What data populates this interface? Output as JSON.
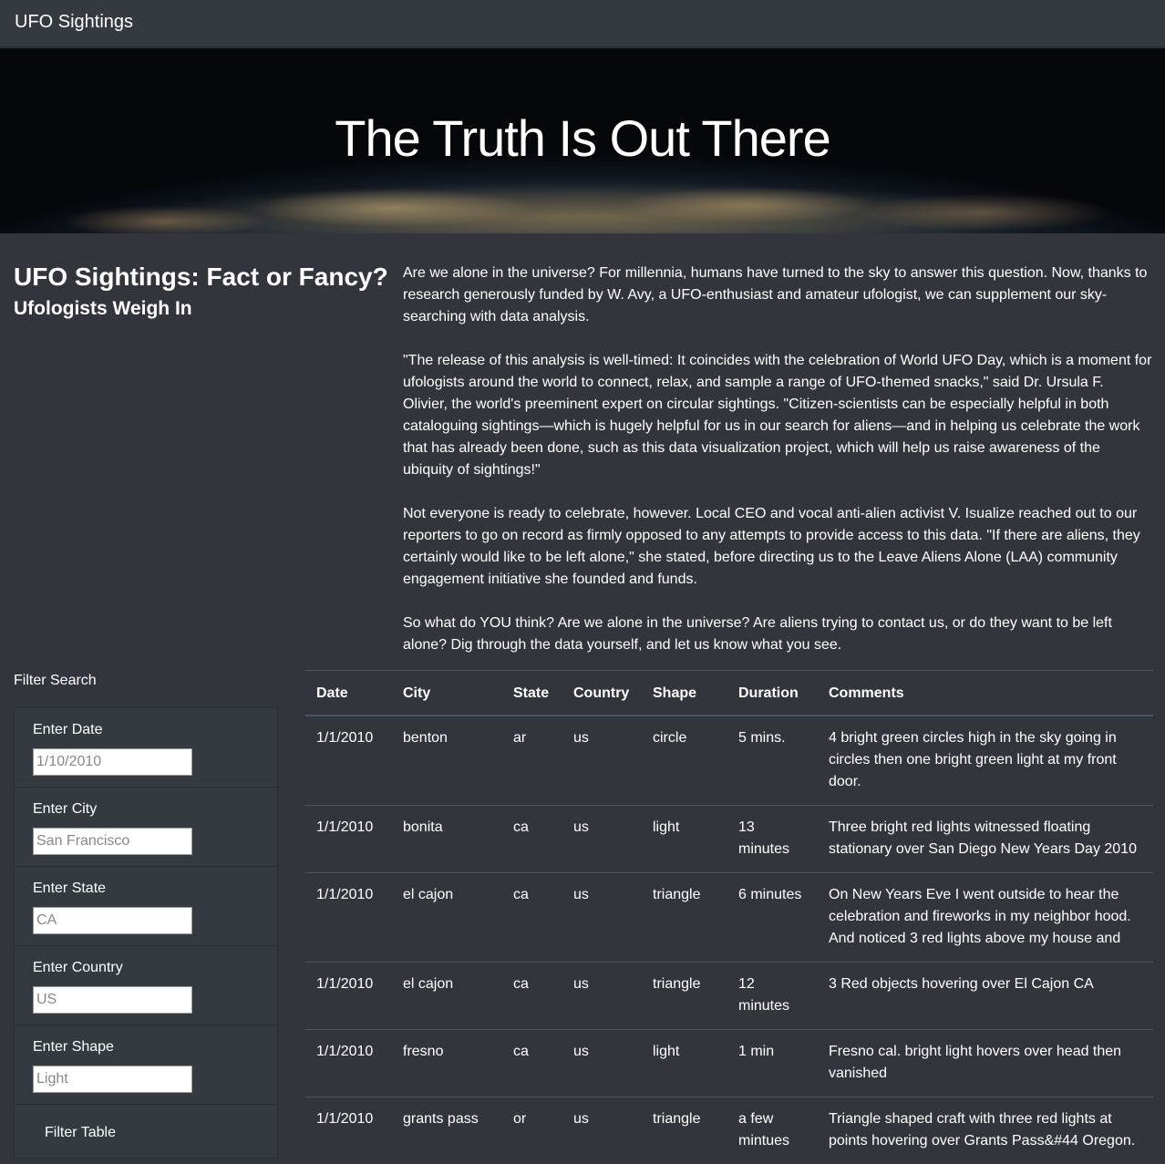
{
  "navbar": {
    "brand": "UFO Sightings"
  },
  "hero": {
    "title": "The Truth Is Out There"
  },
  "intro": {
    "title": "UFO Sightings: Fact or Fancy?",
    "subtitle": "Ufologists Weigh In",
    "paragraphs": [
      "Are we alone in the universe? For millennia, humans have turned to the sky to answer this question. Now, thanks to research generously funded by W. Avy, a UFO-enthusiast and amateur ufologist, we can supplement our sky-searching with data analysis.",
      "\"The release of this analysis is well-timed: It coincides with the celebration of World UFO Day, which is a moment for ufologists around the world to connect, relax, and sample a range of UFO-themed snacks,\" said Dr. Ursula F. Olivier, the world's preeminent expert on circular sightings. \"Citizen-scientists can be especially helpful in both cataloguing sightings—which is hugely helpful for us in our search for aliens—and in helping us celebrate the work that has already been done, such as this data visualization project, which will help us raise awareness of the ubiquity of sightings!\"",
      "Not everyone is ready to celebrate, however. Local CEO and vocal anti-alien activist V. Isualize reached out to our reporters to go on record as firmly opposed to any attempts to provide access to this data. \"If there are aliens, they certainly would like to be left alone,\" she stated, before directing us to the Leave Aliens Alone (LAA) community engagement initiative she founded and funds.",
      "So what do YOU think? Are we alone in the universe? Are aliens trying to contact us, or do they want to be left alone? Dig through the data yourself, and let us know what you see."
    ]
  },
  "filters": {
    "heading": "Filter Search",
    "items": [
      {
        "label": "Enter Date",
        "placeholder": "1/10/2010"
      },
      {
        "label": "Enter City",
        "placeholder": "San Francisco"
      },
      {
        "label": "Enter State",
        "placeholder": "CA"
      },
      {
        "label": "Enter Country",
        "placeholder": "US"
      },
      {
        "label": "Enter Shape",
        "placeholder": "Light"
      }
    ],
    "button_label": "Filter Table"
  },
  "table": {
    "headers": [
      "Date",
      "City",
      "State",
      "Country",
      "Shape",
      "Duration",
      "Comments"
    ],
    "rows": [
      [
        "1/1/2010",
        "benton",
        "ar",
        "us",
        "circle",
        "5 mins.",
        "4 bright green circles high in the sky going in circles then one bright green light at my front door."
      ],
      [
        "1/1/2010",
        "bonita",
        "ca",
        "us",
        "light",
        "13 minutes",
        "Three bright red lights witnessed floating stationary over San Diego New Years Day 2010"
      ],
      [
        "1/1/2010",
        "el cajon",
        "ca",
        "us",
        "triangle",
        "6 minutes",
        "On New Years Eve I went outside to hear the celebration and fireworks in my neighbor hood. And noticed 3 red lights above my house and"
      ],
      [
        "1/1/2010",
        "el cajon",
        "ca",
        "us",
        "triangle",
        "12 minutes",
        "3 Red objects hovering over El Cajon CA"
      ],
      [
        "1/1/2010",
        "fresno",
        "ca",
        "us",
        "light",
        "1 min",
        "Fresno cal. bright light hovers over head then vanished"
      ],
      [
        "1/1/2010",
        "grants pass",
        "or",
        "us",
        "triangle",
        "a few mintues",
        "Triangle shaped craft with three red lights at points hovering over Grants Pass&#44 Oregon."
      ]
    ]
  }
}
